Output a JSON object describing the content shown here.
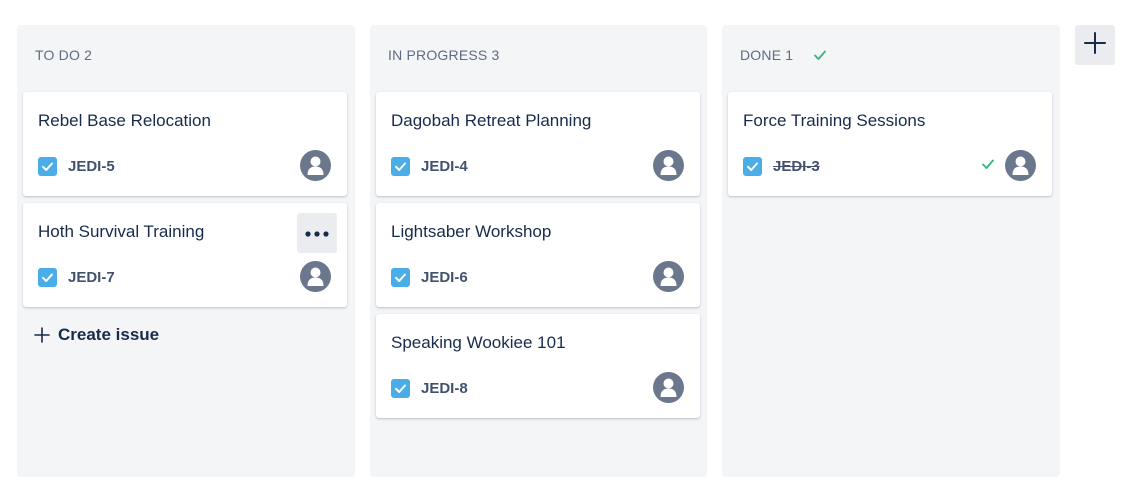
{
  "colors": {
    "column_bg": "#f4f5f7",
    "card_bg": "#ffffff",
    "checkbox": "#4bade8",
    "avatar": "#6b778c",
    "done_check": "#36b37e",
    "text_primary": "#172b4d",
    "text_secondary": "#5e6c84"
  },
  "columns": [
    {
      "title": "TO DO",
      "count": "2",
      "cards": [
        {
          "title": "Rebel Base Relocation",
          "key": "JEDI-5"
        },
        {
          "title": "Hoth Survival Training",
          "key": "JEDI-7"
        }
      ],
      "create_issue_label": "Create issue"
    },
    {
      "title": "IN PROGRESS",
      "count": "3",
      "cards": [
        {
          "title": "Dagobah Retreat Planning",
          "key": "JEDI-4"
        },
        {
          "title": "Lightsaber Workshop",
          "key": "JEDI-6"
        },
        {
          "title": "Speaking Wookiee 101",
          "key": "JEDI-8"
        }
      ]
    },
    {
      "title": "DONE",
      "count": "1",
      "done_icon": "check-icon",
      "cards": [
        {
          "title": "Force Training Sessions",
          "key": "JEDI-3",
          "resolved": true
        }
      ]
    }
  ],
  "icons": {
    "card_type": "checkbox-icon",
    "assignee": "avatar-icon",
    "more": "more-icon",
    "add_column": "plus-icon"
  }
}
